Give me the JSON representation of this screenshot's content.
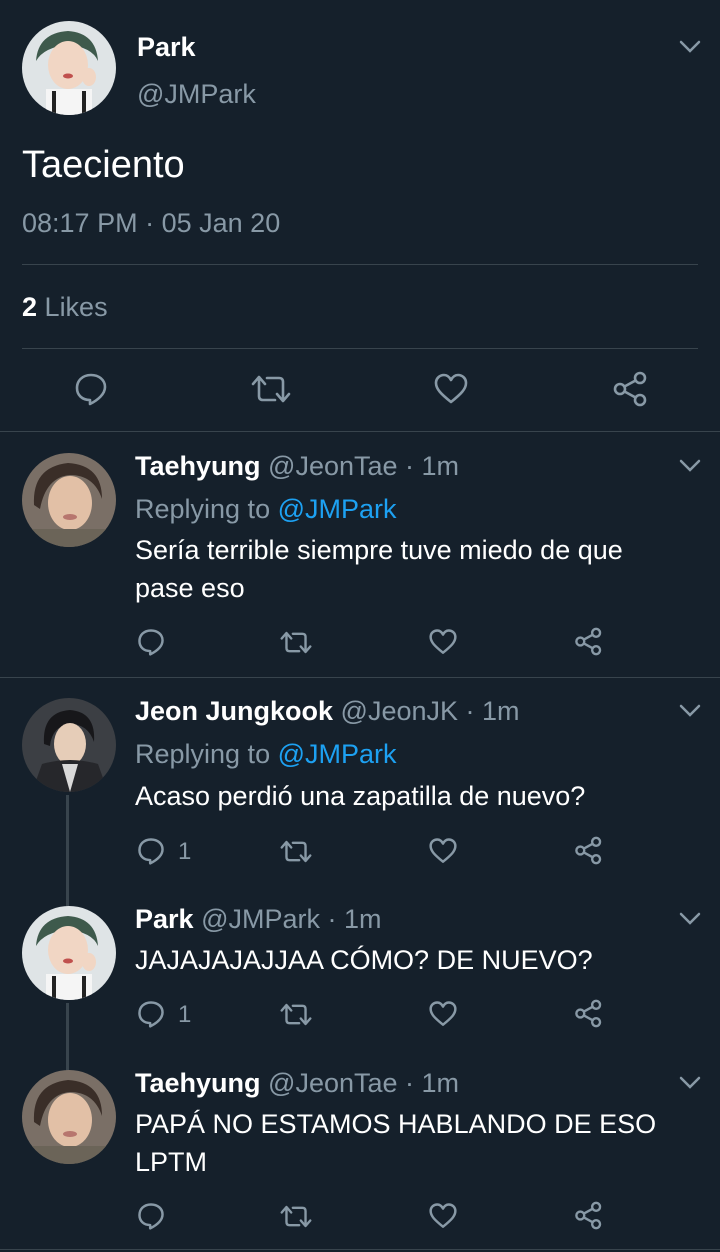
{
  "main": {
    "name": "Park",
    "handle": "@JMPark",
    "text": "Taeciento",
    "time": "08:17 PM",
    "sep": "·",
    "date": "05 Jan 20",
    "likes_count": "2",
    "likes_label": "Likes"
  },
  "replies": [
    {
      "name": "Taehyung",
      "handle": "@JeonTae",
      "age": "· 1m",
      "replying_prefix": "Replying to",
      "replying_to": "@JMPark",
      "text_line1": "Sería terrible siempre tuve miedo de que",
      "text_line2": "pase eso"
    },
    {
      "name": "Jeon Jungkook",
      "handle": "@JeonJK",
      "age": "· 1m",
      "replying_prefix": "Replying to",
      "replying_to": "@JMPark",
      "text_line1": "Acaso perdió una zapatilla de nuevo?",
      "reply_count": "1"
    },
    {
      "name": "Park",
      "handle": "@JMPark",
      "age": "· 1m",
      "text_line1": "JAJAJAJAJJAA CÓMO? DE NUEVO?",
      "reply_count": "1"
    },
    {
      "name": "Taehyung",
      "handle": "@JeonTae",
      "age": "· 1m",
      "text_line1": "PAPÁ NO ESTAMOS HABLANDO DE ESO",
      "text_line2": "LPTM"
    }
  ],
  "icons": {
    "reply": "reply-icon",
    "retweet": "retweet-icon",
    "like": "heart-icon",
    "share": "share-icon",
    "more": "chevron-down-icon"
  },
  "colors": {
    "background": "#15202b",
    "muted": "#8899a6",
    "link": "#1da1f2",
    "divider": "#38444d"
  }
}
